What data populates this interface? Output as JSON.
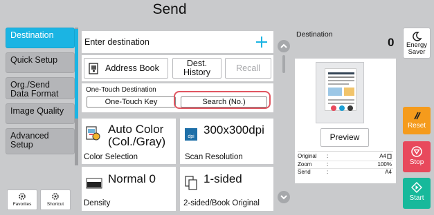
{
  "header": {
    "title": "Send"
  },
  "sidebar": {
    "items": [
      {
        "label": "Destination"
      },
      {
        "label": "Quick Setup"
      },
      {
        "label": "Org./Send Data Format"
      },
      {
        "label": "Image Quality"
      },
      {
        "label": "Advanced Setup"
      }
    ],
    "favorites_label": "Favorites",
    "shortcut_label": "Shortcut"
  },
  "destination_input": {
    "placeholder": "Enter destination"
  },
  "buttons": {
    "address_book": "Address Book",
    "dest_history": "Dest. History",
    "recall": "Recall"
  },
  "one_touch": {
    "title": "One-Touch Destination",
    "key_label": "One-Touch Key",
    "search_label": "Search (No.)"
  },
  "settings": {
    "color": {
      "value": "Auto Color (Col./Gray)",
      "label": "Color Selection"
    },
    "resolution": {
      "value": "300x300dpi",
      "label": "Scan Resolution"
    },
    "density": {
      "value": "Normal 0",
      "label": "Density"
    },
    "sided": {
      "value": "1-sided",
      "label": "2-sided/Book Original"
    }
  },
  "preview": {
    "destination_label": "Destination",
    "destination_count": "0",
    "button_label": "Preview",
    "rows": [
      {
        "label": "Original",
        "sep": ":",
        "value": "A4"
      },
      {
        "label": "Zoom",
        "sep": ":",
        "value": "100%"
      },
      {
        "label": "Send",
        "sep": ":",
        "value": "A4"
      }
    ]
  },
  "right_panel": {
    "energy_saver": "Energy Saver",
    "reset": "Reset",
    "stop": "Stop",
    "start": "Start"
  },
  "colors": {
    "accent": "#1bb4e3",
    "orange": "#f59b1c",
    "red": "#e8495c",
    "green": "#17b99b",
    "highlight": "#e05560"
  }
}
